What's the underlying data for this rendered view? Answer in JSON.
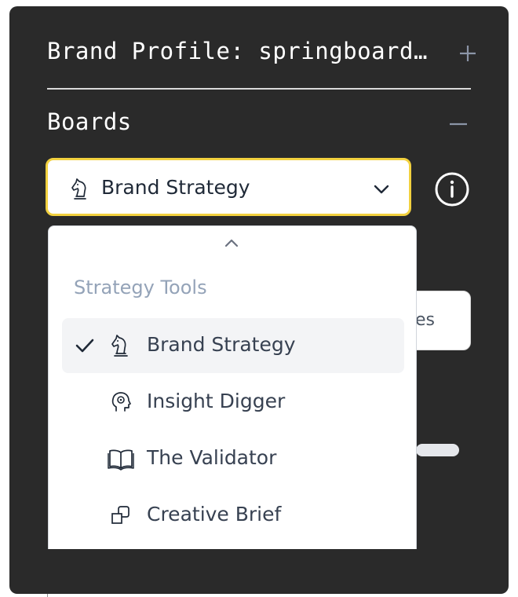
{
  "header": {
    "brand_profile_title": "Brand Profile: springboard…",
    "boards_title": "Boards"
  },
  "board_select": {
    "selected_label": "Brand Strategy",
    "selected_icon": "knight-icon"
  },
  "hidden_card": {
    "text_fragment": "es"
  },
  "dropdown": {
    "group_label": "Strategy Tools",
    "options": [
      {
        "label": "Brand Strategy",
        "icon": "knight-icon",
        "selected": true
      },
      {
        "label": "Insight Digger",
        "icon": "head-icon",
        "selected": false
      },
      {
        "label": "The Validator",
        "icon": "book-icon",
        "selected": false
      },
      {
        "label": "Creative Brief",
        "icon": "shapes-icon",
        "selected": false
      }
    ]
  },
  "colors": {
    "panel_background": "#2a2a2a",
    "focus_border": "#f2d13f",
    "selected_option_bg": "#f3f4f6",
    "group_label": "#94a3b8",
    "text_dark": "#374151"
  }
}
